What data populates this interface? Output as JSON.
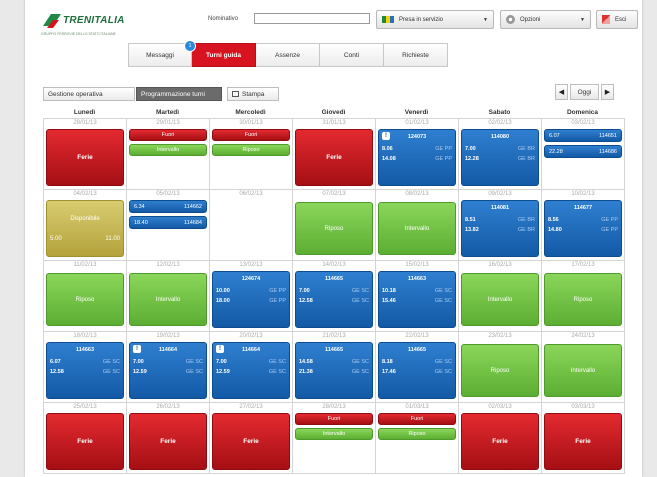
{
  "header": {
    "logo_text": "TRENITALIA",
    "logo_sub": "GRUPPO FERROVIE DELLO STATO ITALIANE",
    "user_label": "Nominativo",
    "user_value": "",
    "presa_label": "Presa in servizio",
    "opzioni_label": "Opzioni",
    "esci_label": "Esci"
  },
  "tabs": [
    {
      "label": "Messaggi"
    },
    {
      "label": "Turni guida"
    },
    {
      "label": "Assenze"
    },
    {
      "label": "Conti"
    },
    {
      "label": "Richieste"
    }
  ],
  "tab_badge": "1",
  "toolbar": {
    "gestione_label": "Gestione operativa",
    "programmazione_label": "Programmazione turni",
    "stampa_label": "Stampa",
    "oggi_label": "Oggi",
    "prev_arrow": "◀",
    "next_arrow": "▶"
  },
  "days": [
    "Lunedì",
    "Martedì",
    "Mercoledì",
    "Giovedì",
    "Venerdì",
    "Sabato",
    "Domenica"
  ],
  "weeks": [
    [
      {
        "date": "28/01/13",
        "events": [
          {
            "kind": "red-block",
            "label": "Ferie"
          }
        ]
      },
      {
        "date": "29/01/13",
        "events": [
          {
            "kind": "red-small",
            "label": "Fuori"
          },
          {
            "kind": "green-small",
            "label": "Intervallo"
          }
        ]
      },
      {
        "date": "30/01/13",
        "events": [
          {
            "kind": "red-small",
            "label": "Fuori"
          },
          {
            "kind": "green-small",
            "label": "Riposo"
          }
        ]
      },
      {
        "date": "31/01/13",
        "events": [
          {
            "kind": "red-block",
            "label": "Ferie"
          }
        ]
      },
      {
        "date": "01/02/13",
        "events": [
          {
            "kind": "blue-block",
            "alert": true,
            "train": "124073",
            "rows": [
              {
                "t": "8.06",
                "s": "GE PP"
              },
              {
                "t": "14.08",
                "s": "GE PP"
              }
            ]
          }
        ]
      },
      {
        "date": "02/02/13",
        "events": [
          {
            "kind": "blue-block",
            "alert": false,
            "train": "114080",
            "rows": [
              {
                "t": "7.00",
                "s": "GE BR"
              },
              {
                "t": "12.28",
                "s": "GE BR"
              }
            ]
          }
        ]
      },
      {
        "date": "03/02/13",
        "events": [
          {
            "kind": "blue-small",
            "left": "6.07",
            "right": "114651"
          },
          {
            "kind": "blue-small",
            "left": "22.28",
            "right": "114686"
          }
        ]
      }
    ],
    [
      {
        "date": "04/02/13",
        "events": [
          {
            "kind": "gold-block",
            "label": "Disponibile",
            "left": "5.00",
            "right": "11.00"
          }
        ]
      },
      {
        "date": "05/02/13",
        "events": [
          {
            "kind": "blue-small",
            "left": "6.34",
            "right": "114662"
          },
          {
            "kind": "blue-small",
            "left": "18.40",
            "right": "114684"
          }
        ]
      },
      {
        "date": "06/02/13",
        "events": []
      },
      {
        "date": "07/02/13",
        "events": [
          {
            "kind": "green-block",
            "label": "Riposo"
          }
        ]
      },
      {
        "date": "08/02/13",
        "events": [
          {
            "kind": "green-block",
            "label": "Intervallo"
          }
        ]
      },
      {
        "date": "09/02/13",
        "events": [
          {
            "kind": "blue-block",
            "alert": false,
            "train": "114081",
            "rows": [
              {
                "t": "8.51",
                "s": "GE BR"
              },
              {
                "t": "13.82",
                "s": "GE BR"
              }
            ]
          }
        ]
      },
      {
        "date": "10/02/13",
        "events": [
          {
            "kind": "blue-block",
            "alert": false,
            "train": "114677",
            "rows": [
              {
                "t": "8.56",
                "s": "GE PP"
              },
              {
                "t": "14.80",
                "s": "GE PP"
              }
            ]
          }
        ]
      }
    ],
    [
      {
        "date": "11/02/13",
        "events": [
          {
            "kind": "green-block",
            "label": "Riposo"
          }
        ]
      },
      {
        "date": "12/02/13",
        "events": [
          {
            "kind": "green-block",
            "label": "Intervallo"
          }
        ]
      },
      {
        "date": "13/02/13",
        "events": [
          {
            "kind": "blue-block",
            "alert": false,
            "train": "124674",
            "rows": [
              {
                "t": "10.00",
                "s": "GE PP"
              },
              {
                "t": "18.00",
                "s": "GE PP"
              }
            ]
          }
        ]
      },
      {
        "date": "14/02/13",
        "events": [
          {
            "kind": "blue-block",
            "alert": false,
            "train": "114665",
            "rows": [
              {
                "t": "7.00",
                "s": "GE SC"
              },
              {
                "t": "12.58",
                "s": "GE SC"
              }
            ]
          }
        ]
      },
      {
        "date": "15/02/13",
        "events": [
          {
            "kind": "blue-block",
            "alert": false,
            "train": "114663",
            "rows": [
              {
                "t": "10.18",
                "s": "GE SC"
              },
              {
                "t": "15.46",
                "s": "GE SC"
              }
            ]
          }
        ]
      },
      {
        "date": "16/02/13",
        "events": [
          {
            "kind": "green-block",
            "label": "Intervallo"
          }
        ]
      },
      {
        "date": "17/02/13",
        "events": [
          {
            "kind": "green-block",
            "label": "Riposo"
          }
        ]
      }
    ],
    [
      {
        "date": "18/02/13",
        "events": [
          {
            "kind": "blue-block",
            "alert": false,
            "train": "114663",
            "rows": [
              {
                "t": "6.07",
                "s": "GE SC"
              },
              {
                "t": "12.58",
                "s": "GE SC"
              }
            ]
          }
        ]
      },
      {
        "date": "19/02/13",
        "events": [
          {
            "kind": "blue-block",
            "alert": true,
            "train": "114664",
            "rows": [
              {
                "t": "7.00",
                "s": "GE SC"
              },
              {
                "t": "12.59",
                "s": "GE SC"
              }
            ]
          }
        ]
      },
      {
        "date": "20/02/13",
        "events": [
          {
            "kind": "blue-block",
            "alert": true,
            "train": "114664",
            "rows": [
              {
                "t": "7.00",
                "s": "GE SC"
              },
              {
                "t": "12.59",
                "s": "GE SC"
              }
            ]
          }
        ]
      },
      {
        "date": "21/02/13",
        "events": [
          {
            "kind": "blue-block",
            "alert": false,
            "train": "114665",
            "rows": [
              {
                "t": "14.58",
                "s": "GE SC"
              },
              {
                "t": "21.38",
                "s": "GE SC"
              }
            ]
          }
        ]
      },
      {
        "date": "22/02/13",
        "events": [
          {
            "kind": "blue-block",
            "alert": false,
            "train": "114665",
            "rows": [
              {
                "t": "8.18",
                "s": "GE SC"
              },
              {
                "t": "17.46",
                "s": "GE SC"
              }
            ]
          }
        ]
      },
      {
        "date": "23/02/13",
        "events": [
          {
            "kind": "green-block",
            "label": "Riposo"
          }
        ]
      },
      {
        "date": "24/02/13",
        "events": [
          {
            "kind": "green-block",
            "label": "Intervallo"
          }
        ]
      }
    ],
    [
      {
        "date": "25/02/13",
        "events": [
          {
            "kind": "red-block",
            "label": "Ferie"
          }
        ]
      },
      {
        "date": "26/02/13",
        "events": [
          {
            "kind": "red-block",
            "label": "Ferie"
          }
        ]
      },
      {
        "date": "27/02/13",
        "events": [
          {
            "kind": "red-block",
            "label": "Ferie"
          }
        ]
      },
      {
        "date": "28/02/13",
        "events": [
          {
            "kind": "red-small",
            "label": "Fuori"
          },
          {
            "kind": "green-small",
            "label": "Intervallo"
          }
        ]
      },
      {
        "date": "01/03/13",
        "events": [
          {
            "kind": "red-small",
            "label": "Fuori"
          },
          {
            "kind": "green-small",
            "label": "Riposo"
          }
        ]
      },
      {
        "date": "02/03/13",
        "events": [
          {
            "kind": "red-block",
            "label": "Ferie"
          }
        ]
      },
      {
        "date": "03/03/13",
        "events": [
          {
            "kind": "red-block",
            "label": "Ferie"
          }
        ]
      }
    ]
  ]
}
